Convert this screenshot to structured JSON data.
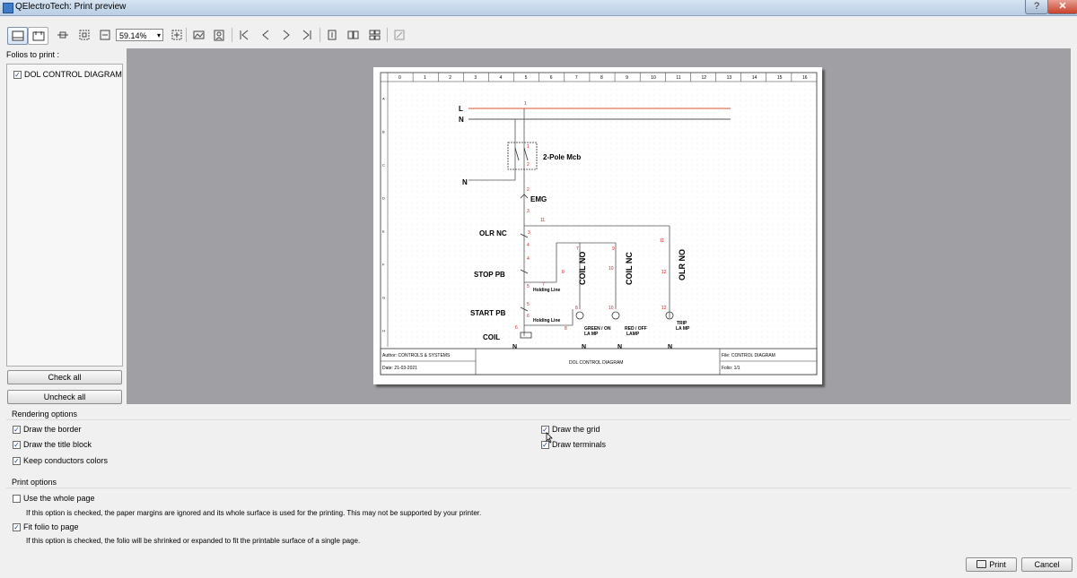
{
  "window": {
    "title": "QElectroTech: Print preview",
    "help_label": "?",
    "close_label": "✕"
  },
  "toolbar": {
    "zoom_value": "59.14%",
    "zoom_arrow": "▾",
    "icons": {
      "fit_width": "⊟",
      "fit_page": "⊞",
      "zoom_out": "−",
      "zoom_in": "+",
      "first": "|<",
      "prev": "<",
      "next": ">",
      "last": ">|"
    }
  },
  "sidebar": {
    "folios_label": "Folios to print :",
    "folios": [
      {
        "label": "DOL CONTROL DIAGRAM",
        "checked": true
      }
    ],
    "check_all_label": "Check all",
    "uncheck_all_label": "Uncheck all"
  },
  "diagram": {
    "column_numbers": [
      "0",
      "1",
      "2",
      "3",
      "4",
      "5",
      "6",
      "7",
      "8",
      "9",
      "10",
      "11",
      "12",
      "13",
      "14",
      "15",
      "16"
    ],
    "row_letters": [
      "A",
      "B",
      "C",
      "D",
      "E",
      "F",
      "G",
      "H"
    ],
    "labels": {
      "L": "L",
      "N": "N",
      "N2": "N",
      "mcb": "2-Pole Mcb",
      "emg": "EMG",
      "olr_nc": "OLR NC",
      "stop_pb": "STOP PB",
      "start_pb": "START PB",
      "coil": "COIL",
      "coil_no": "COIL NO",
      "coil_nc": "COIL NC",
      "olr_no": "OLR NO",
      "holding_line_1": "Holding Line",
      "holding_line_2": "Holding Line",
      "green_lamp": "GREEN / ON",
      "green_lamp2": "LA MP",
      "red_lamp": "RED / OFF",
      "red_lamp2": "LAMP",
      "trip_lamp": "TRIP",
      "trip_lamp2": "LA MP",
      "n_bottom_1": "N",
      "n_bottom_2": "N",
      "n_bottom_3": "N",
      "n_bottom_4": "N"
    },
    "wire_numbers": {
      "w1": "1",
      "w1b": "1",
      "w2": "2",
      "w2b": "2",
      "w3": "3",
      "w3b": "3",
      "w4": "4",
      "w4b": "4",
      "w5": "5",
      "w5b": "5",
      "w6": "6",
      "w6b": "6",
      "w7": "7",
      "w7b": "7",
      "w8": "8",
      "w8b": "8",
      "w8c": "8",
      "w9": "9",
      "w10": "10",
      "w10b": "10",
      "w11": "11",
      "w11b": "11",
      "w12": "12",
      "w12b": "12"
    },
    "title_block": {
      "author": "Author: CONTROLS & SYSTEMS",
      "date": "Date: 21-03-2021",
      "title": "DOL CONTROL DIAGRAM",
      "file": "File: CONTROL DIAGRAM",
      "folio": "Folio: 1/1"
    },
    "colors": {
      "phase_line": "#d9542b",
      "wire": "#555555",
      "wire_number": "#d11a1a"
    }
  },
  "rendering": {
    "label": "Rendering options",
    "draw_border": {
      "label": "Draw the border",
      "checked": true
    },
    "draw_title_block": {
      "label": "Draw the title block",
      "checked": true
    },
    "keep_colors": {
      "label": "Keep conductors colors",
      "checked": true
    },
    "draw_grid": {
      "label": "Draw the grid",
      "checked": true
    },
    "draw_terminals": {
      "label": "Draw terminals",
      "checked": true
    }
  },
  "print_options": {
    "label": "Print options",
    "whole_page": {
      "label": "Use the whole page",
      "checked": false,
      "description": "If this option is checked, the paper margins are ignored and its whole surface is used for the printing. This may not be supported by your printer."
    },
    "fit_folio": {
      "label": "Fit folio to page",
      "checked": true,
      "description": "If this option is checked, the folio will be shrinked or expanded to fit the printable surface of a single page."
    }
  },
  "actions": {
    "print_label": "Print",
    "cancel_label": "Cancel"
  },
  "checkmark": "✓"
}
